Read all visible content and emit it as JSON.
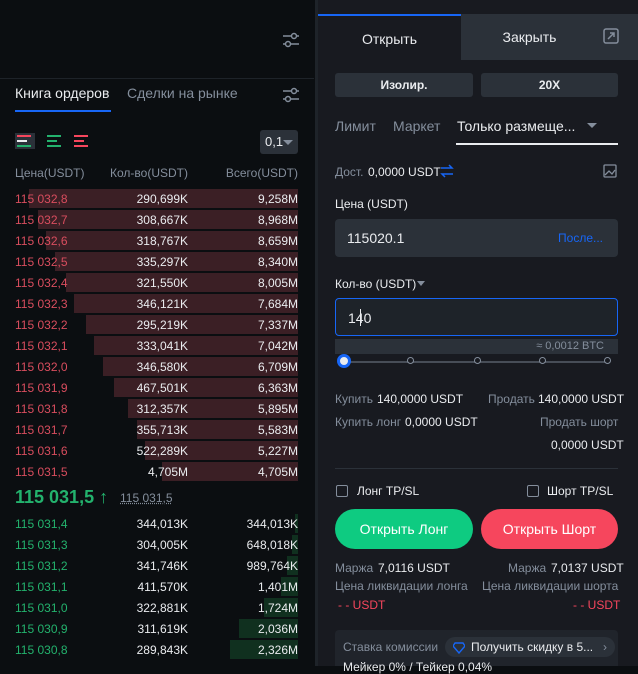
{
  "left_top": {
    "filter_icon": "filter-icon"
  },
  "orderbook": {
    "tab_active": "Книга ордеров",
    "tab_inactive": "Сделки на рынке",
    "precision": "0,1",
    "headers": {
      "price": "Цена(USDT)",
      "qty": "Кол-во(USDT)",
      "total": "Всего(USDT)"
    },
    "asks": [
      {
        "price": "115 032,8",
        "qty": "290,699K",
        "total": "9,258M",
        "depth": 0.95
      },
      {
        "price": "115 032,7",
        "qty": "308,667K",
        "total": "8,968M",
        "depth": 0.92
      },
      {
        "price": "115 032,6",
        "qty": "318,767K",
        "total": "8,659M",
        "depth": 0.89
      },
      {
        "price": "115 032,5",
        "qty": "335,297K",
        "total": "8,340M",
        "depth": 0.86
      },
      {
        "price": "115 032,4",
        "qty": "321,550K",
        "total": "8,005M",
        "depth": 0.82
      },
      {
        "price": "115 032,3",
        "qty": "346,121K",
        "total": "7,684M",
        "depth": 0.79
      },
      {
        "price": "115 032,2",
        "qty": "295,219K",
        "total": "7,337M",
        "depth": 0.75
      },
      {
        "price": "115 032,1",
        "qty": "333,041K",
        "total": "7,042M",
        "depth": 0.72
      },
      {
        "price": "115 032,0",
        "qty": "346,580K",
        "total": "6,709M",
        "depth": 0.69
      },
      {
        "price": "115 031,9",
        "qty": "467,501K",
        "total": "6,363M",
        "depth": 0.65
      },
      {
        "price": "115 031,8",
        "qty": "312,357K",
        "total": "5,895M",
        "depth": 0.6
      },
      {
        "price": "115 031,7",
        "qty": "355,713K",
        "total": "5,583M",
        "depth": 0.57
      },
      {
        "price": "115 031,6",
        "qty": "522,289K",
        "total": "5,227M",
        "depth": 0.54
      },
      {
        "price": "115 031,5",
        "qty": "4,705M",
        "total": "4,705M",
        "depth": 0.48
      }
    ],
    "mid_price": "115 031,5 ↑",
    "mid_sub": "115 031,5",
    "bids": [
      {
        "price": "115 031,4",
        "qty": "344,013K",
        "total": "344,013K",
        "depth": 0.01
      },
      {
        "price": "115 031,3",
        "qty": "304,005K",
        "total": "648,018K",
        "depth": 0.02
      },
      {
        "price": "115 031,2",
        "qty": "341,746K",
        "total": "989,764K",
        "depth": 0.04
      },
      {
        "price": "115 031,1",
        "qty": "411,570K",
        "total": "1,401M",
        "depth": 0.06
      },
      {
        "price": "115 031,0",
        "qty": "322,881K",
        "total": "1,724M",
        "depth": 0.12
      },
      {
        "price": "115 030,9",
        "qty": "311,619K",
        "total": "2,036M",
        "depth": 0.21
      },
      {
        "price": "115 030,8",
        "qty": "289,843K",
        "total": "2,326M",
        "depth": 0.24
      }
    ]
  },
  "trade": {
    "tab_open": "Открыть",
    "tab_close": "Закрыть",
    "margin_mode": "Изолир.",
    "leverage": "20X",
    "order_types": [
      "Лимит",
      "Маркет",
      "Только размеще..."
    ],
    "available_label": "Дост.",
    "available_value": "0,0000 USDT",
    "price_label": "Цена (USDT)",
    "price_value": "115020.1",
    "price_suffix": "После...",
    "qty_label": "Кол-во (USDT)",
    "qty_value": "140",
    "qty_hint": "≈ 0,0012 BTC",
    "buy_label": "Купить",
    "buy_value": "140,0000 USDT",
    "sell_label": "Продать",
    "sell_value": "140,0000 USDT",
    "buy_long_label": "Купить лонг",
    "buy_long_value": "0,0000 USDT",
    "sell_short_label": "Продать шорт",
    "sell_short_value": "0,0000 USDT",
    "long_tpsl": "Лонг TP/SL",
    "short_tpsl": "Шорт TP/SL",
    "open_long": "Открыть Лонг",
    "open_short": "Открыть Шорт",
    "margin_long_label": "Маржа",
    "margin_long_value": "7,0116 USDT",
    "margin_short_label": "Маржа",
    "margin_short_value": "7,0137 USDT",
    "liq_long_label": "Цена ликвидации лонга",
    "liq_short_label": "Цена ликвидации шорта",
    "liq_long_value": "- - USDT",
    "liq_short_value": "- - USDT",
    "fee_label": "Ставка комиссии",
    "promo": "Получить скидку в 5...",
    "fee_rates": "Мейкер 0% / Тейкер 0,04%"
  },
  "colors": {
    "accent": "#1766f6",
    "buy": "#23b26d",
    "sell": "#f6465d"
  }
}
